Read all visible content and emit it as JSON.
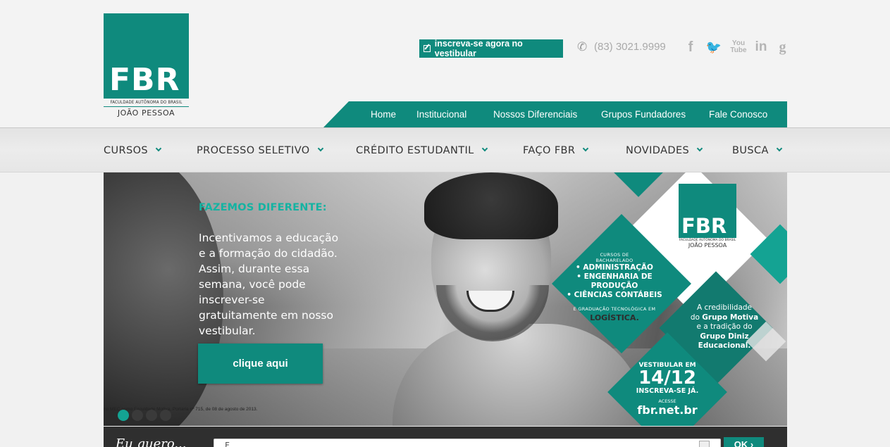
{
  "brand": {
    "logo_text": "FBR",
    "logo_subtitle": "FACULDADE AUTÔNOMA DO BRASIL",
    "logo_city": "JOÃO PESSOA"
  },
  "header": {
    "cta_label": "inscreva-se agora no vestibular",
    "phone": "(83) 3021.9999",
    "social": {
      "facebook": "f",
      "twitter": "🐦",
      "youtube_top": "You",
      "youtube_bottom": "Tube",
      "linkedin": "in",
      "google": "g"
    },
    "top_nav": [
      "Home",
      "Institucional",
      "Nossos Diferenciais",
      "Grupos Fundadores",
      "Fale Conosco"
    ]
  },
  "main_nav": [
    "CURSOS",
    "PROCESSO SELETIVO",
    "CRÉDITO ESTUDANTIL",
    "FAÇO FBR",
    "NOVIDADES",
    "BUSCA"
  ],
  "hero": {
    "title": "FAZEMOS DIFERENTE:",
    "body": "Incentivamos a educação e a formação do cidadão. Assim, durante essa semana, você pode inscrever-se gratuitamente em nosso vestibular.",
    "button": "clique aqui",
    "fine_print": "no MEC como Faculdade Motiva, Portaria nº 715, de 08 de agosto de 2013.",
    "slides": 4,
    "active_slide": 1,
    "badge": {
      "logo_text": "FBR",
      "logo_subtitle": "FACULDADE AUTÔNOMA DO BRASIL",
      "logo_city": "JOÃO PESSOA",
      "courses_head_1": "CURSOS DE",
      "courses_head_2": "BACHARELADO",
      "course_1": "• ADMINISTRAÇÃO",
      "course_2": "• ENGENHARIA DE PRODUÇÃO",
      "course_3": "• CIÊNCIAS CONTÁBEIS",
      "tech_head": "E GRADUAÇÃO TECNOLÓGICA EM",
      "tech_course": "LOGÍSTICA.",
      "cred_1": "A credibilidade",
      "cred_2": "do",
      "cred_3": "Grupo Motiva",
      "cred_4": "e a tradição do",
      "cred_5": "Grupo Diniz",
      "cred_6": "Educacional.",
      "vest_1": "VESTIBULAR EM",
      "vest_date": "14/12",
      "vest_2": "INSCREVA-SE JÁ.",
      "vest_3": "ACESSE",
      "vest_url": "fbr.net.br"
    }
  },
  "bottom": {
    "label": "Eu quero...",
    "input_value": "F",
    "ok_label": "OK ›"
  },
  "colors": {
    "brand_teal": "#0f8a7d",
    "accent_teal": "#14b3a2"
  }
}
